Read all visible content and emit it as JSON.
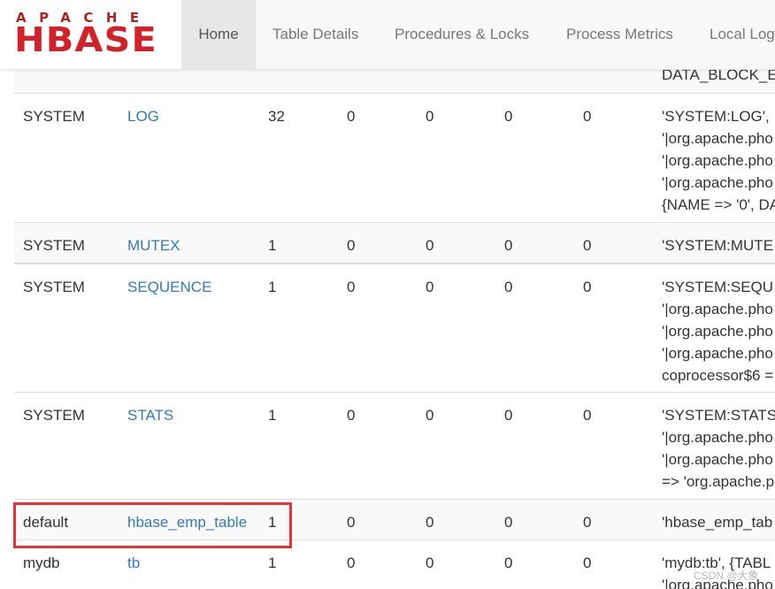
{
  "logo": {
    "top": "APACHE",
    "main": "HBASE"
  },
  "nav": {
    "tabs": [
      {
        "label": "Home",
        "active": true
      },
      {
        "label": "Table Details",
        "active": false
      },
      {
        "label": "Procedures & Locks",
        "active": false
      },
      {
        "label": "Process Metrics",
        "active": false
      },
      {
        "label": "Local Log",
        "active": false
      }
    ]
  },
  "table": {
    "partial_top_desc": "DATA_BLOCK_E",
    "rows": [
      {
        "namespace": "SYSTEM",
        "name": "LOG",
        "regions": [
          "32",
          "0",
          "0",
          "0",
          "0"
        ],
        "desc": [
          "'SYSTEM:LOG',",
          "'|org.apache.pho",
          "'|org.apache.pho",
          "'|org.apache.pho",
          "{NAME => '0', DA"
        ]
      },
      {
        "namespace": "SYSTEM",
        "name": "MUTEX",
        "regions": [
          "1",
          "0",
          "0",
          "0",
          "0"
        ],
        "desc": [
          "'SYSTEM:MUTE"
        ]
      },
      {
        "namespace": "SYSTEM",
        "name": "SEQUENCE",
        "regions": [
          "1",
          "0",
          "0",
          "0",
          "0"
        ],
        "desc": [
          "'SYSTEM:SEQU",
          "'|org.apache.pho",
          "'|org.apache.pho",
          "'|org.apache.pho",
          "coprocessor$6 ="
        ]
      },
      {
        "namespace": "SYSTEM",
        "name": "STATS",
        "regions": [
          "1",
          "0",
          "0",
          "0",
          "0"
        ],
        "desc": [
          "'SYSTEM:STATS",
          "'|org.apache.pho",
          "'|org.apache.pho",
          "=> 'org.apache.p"
        ]
      },
      {
        "namespace": "default",
        "name": "hbase_emp_table",
        "regions": [
          "1",
          "0",
          "0",
          "0",
          "0"
        ],
        "desc": [
          "'hbase_emp_tab"
        ]
      },
      {
        "namespace": "mydb",
        "name": "tb",
        "regions": [
          "1",
          "0",
          "0",
          "0",
          "0"
        ],
        "desc": [
          "'mydb:tb', {TABL",
          "'|org.apache.pho"
        ]
      }
    ]
  },
  "highlight_color": "#e8323a",
  "watermark": "CSDN @大象"
}
